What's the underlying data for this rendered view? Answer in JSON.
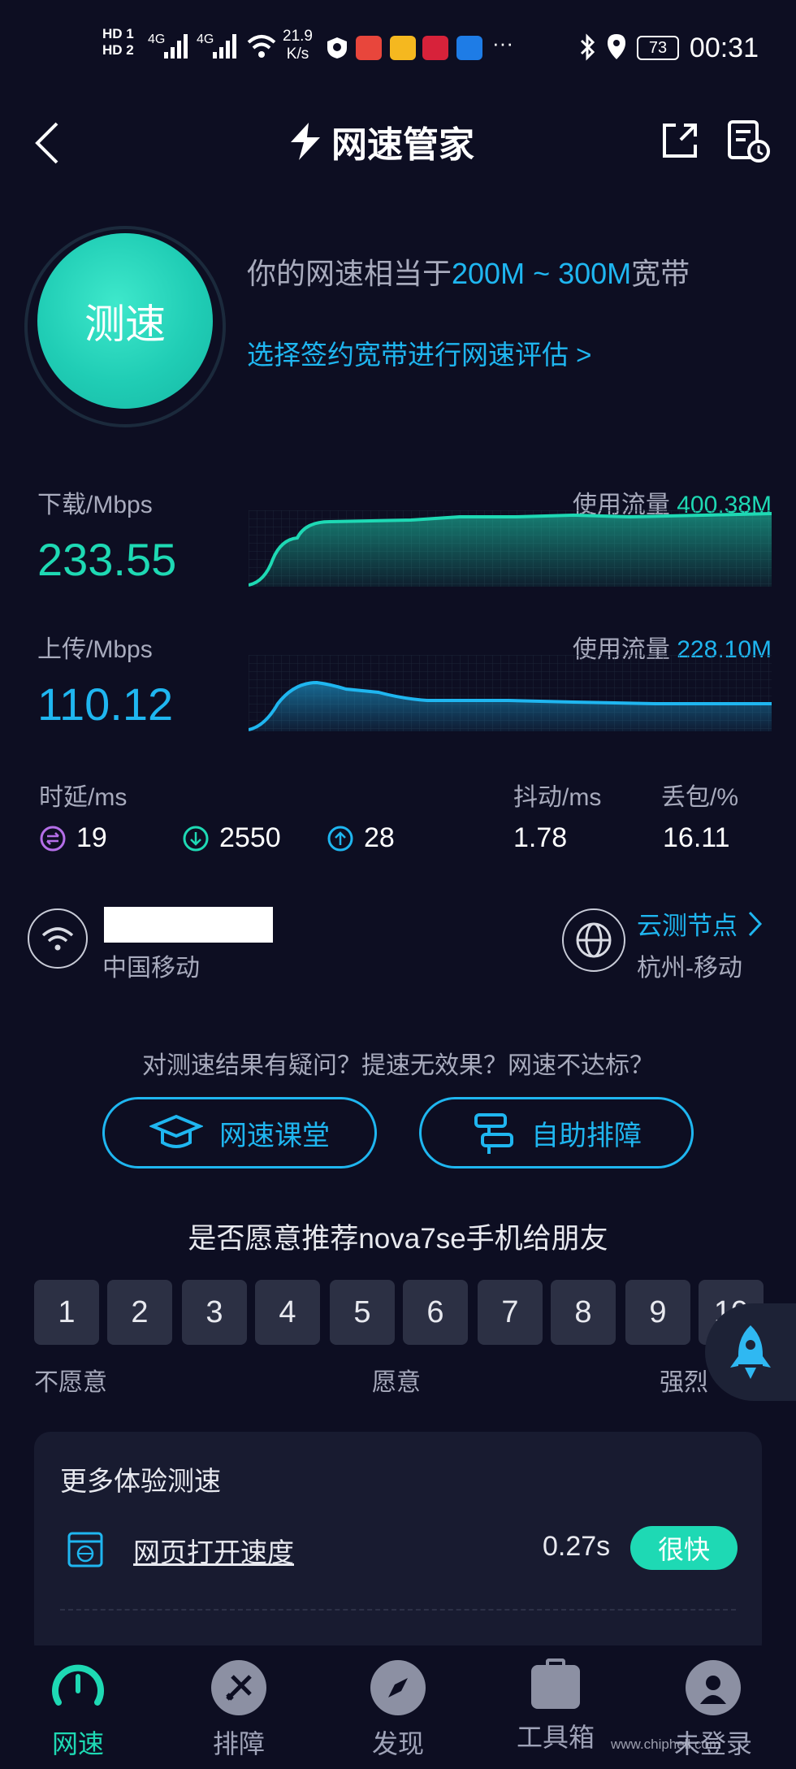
{
  "status_bar": {
    "hd1": "HD 1",
    "hd2": "HD 2",
    "net1": "4G",
    "net2": "4G",
    "speed_value": "21.9",
    "speed_unit": "K/s",
    "more": "···",
    "battery": "73",
    "time": "00:31"
  },
  "header": {
    "title": "网速管家"
  },
  "hero": {
    "button_label": "测速",
    "result_prefix": "你的网速相当于",
    "result_range": "200M ~ 300M",
    "result_suffix": "宽带",
    "evaluate_link": "选择签约宽带进行网速评估 >"
  },
  "download": {
    "label": "下载/Mbps",
    "value": "233.55",
    "usage_label": "使用流量",
    "usage_value": "400.38M",
    "usage_fraction": 0.98
  },
  "upload": {
    "label": "上传/Mbps",
    "value": "110.12",
    "usage_label": "使用流量",
    "usage_value": "228.10M"
  },
  "latency": {
    "label": "时延/ms",
    "idle": "19",
    "down": "2550",
    "up": "28"
  },
  "jitter": {
    "label": "抖动/ms",
    "value": "1.78"
  },
  "loss": {
    "label": "丢包/%",
    "value": "16.11"
  },
  "network": {
    "isp": "中国移动",
    "node_link": "云测节点",
    "node_value": "杭州-移动"
  },
  "help": {
    "question": "对测速结果有疑问？提速无效果？网速不达标？",
    "class_button": "网速课堂",
    "diagnose_button": "自助排障"
  },
  "survey": {
    "question": "是否愿意推荐nova7se手机给朋友",
    "scores": [
      "1",
      "2",
      "3",
      "4",
      "5",
      "6",
      "7",
      "8",
      "9",
      "10"
    ],
    "low_label": "不愿意",
    "mid_label": "愿意",
    "high_label": "强烈"
  },
  "more_tests": {
    "title": "更多体验测速",
    "item_label": "网页打开速度",
    "item_value": "0.27s",
    "item_badge": "很快"
  },
  "bottom_nav": {
    "items": [
      "网速",
      "排障",
      "发现",
      "工具箱",
      "未登录"
    ]
  },
  "watermark": "www.chiphell.com",
  "colors": {
    "background": "#0d0e22",
    "teal": "#1ed9b4",
    "cyan": "#1fb6f0"
  }
}
